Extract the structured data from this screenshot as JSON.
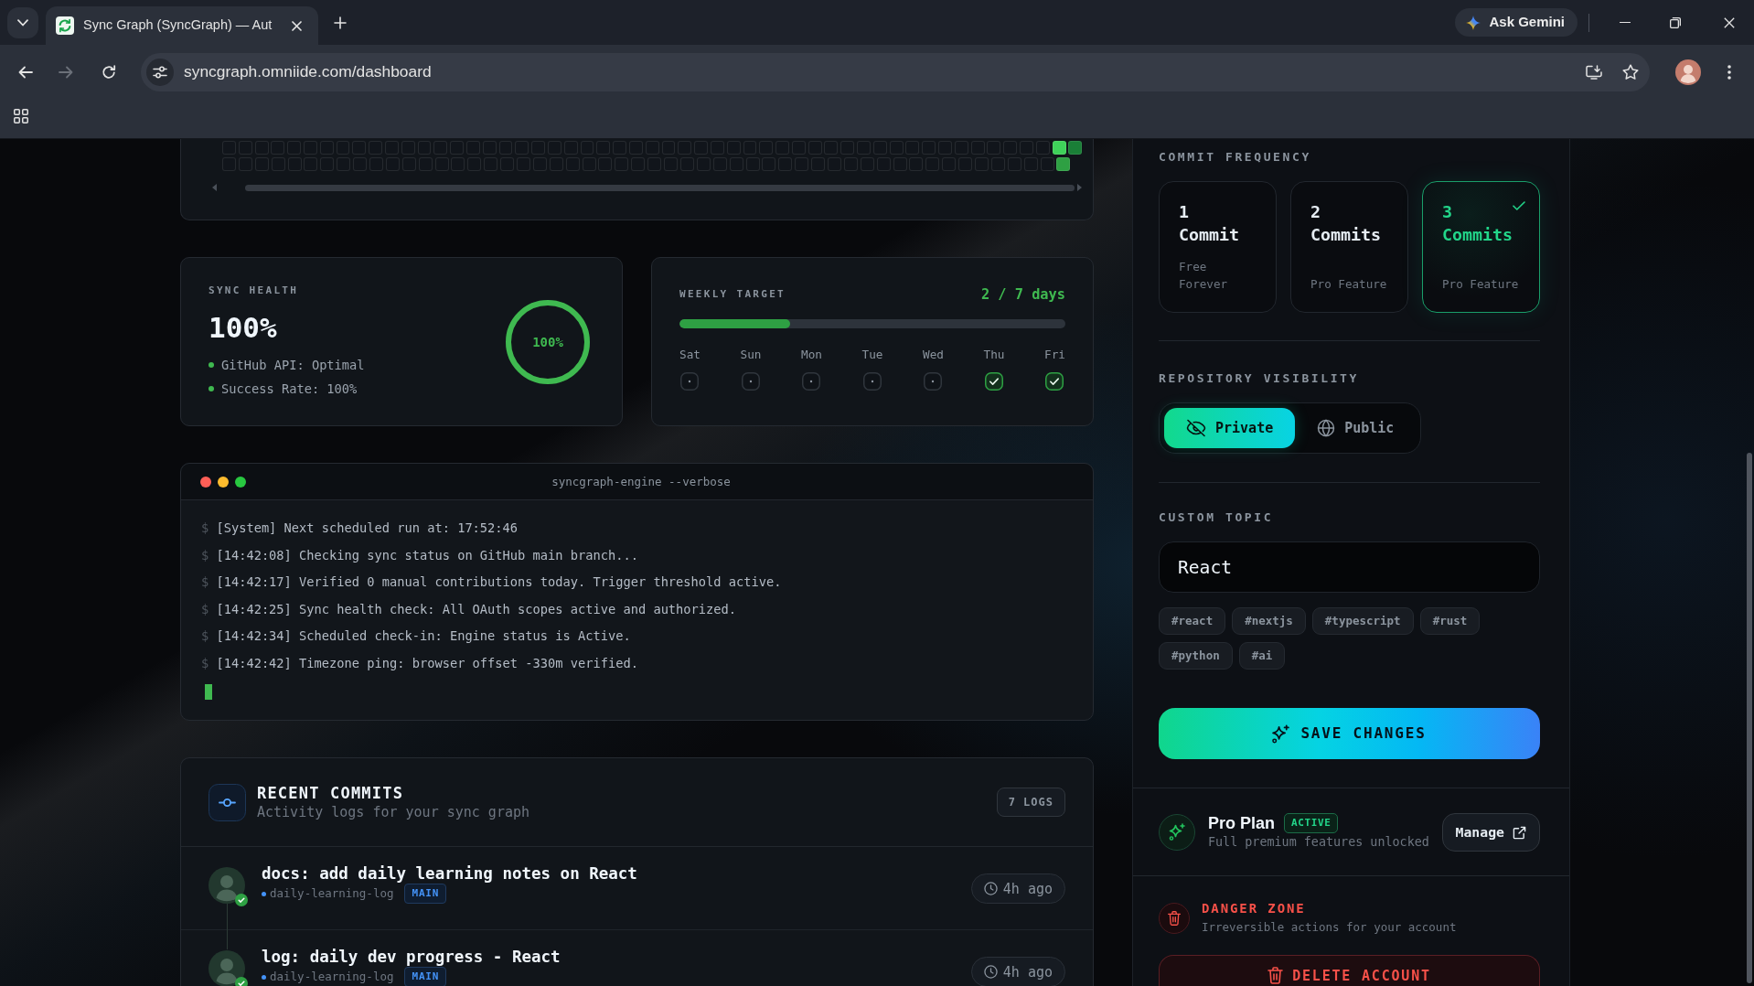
{
  "browser": {
    "tab_title": "Sync Graph (SyncGraph) — Aut",
    "ask_button": "Ask Gemini",
    "nav": [
      {
        "kind": "back",
        "disabled": false
      },
      {
        "kind": "forward",
        "disabled": true
      },
      {
        "kind": "reload",
        "disabled": false
      }
    ],
    "url": "syncgraph.omniide.com/dashboard"
  },
  "contribution_grid": {
    "rows": [
      {
        "cells": [
          {
            "color": "#11151b"
          },
          {
            "color": "#11151b"
          },
          {
            "color": "#11151b"
          },
          {
            "color": "#11151b"
          },
          {
            "color": "#11151b"
          },
          {
            "color": "#11151b"
          },
          {
            "color": "#11151b"
          },
          {
            "color": "#11151b"
          },
          {
            "color": "#11151b"
          },
          {
            "color": "#11151b"
          },
          {
            "color": "#11151b"
          },
          {
            "color": "#11151b"
          },
          {
            "color": "#11151b"
          },
          {
            "color": "#11151b"
          },
          {
            "color": "#11151b"
          },
          {
            "color": "#11151b"
          },
          {
            "color": "#11151b"
          },
          {
            "color": "#11151b"
          },
          {
            "color": "#11151b"
          },
          {
            "color": "#11151b"
          },
          {
            "color": "#11151b"
          },
          {
            "color": "#11151b"
          },
          {
            "color": "#11151b"
          },
          {
            "color": "#11151b"
          },
          {
            "color": "#11151b"
          },
          {
            "color": "#11151b"
          },
          {
            "color": "#11151b"
          },
          {
            "color": "#11151b"
          },
          {
            "color": "#11151b"
          },
          {
            "color": "#11151b"
          },
          {
            "color": "#11151b"
          },
          {
            "color": "#11151b"
          },
          {
            "color": "#11151b"
          },
          {
            "color": "#11151b"
          },
          {
            "color": "#11151b"
          },
          {
            "color": "#11151b"
          },
          {
            "color": "#11151b"
          },
          {
            "color": "#11151b"
          },
          {
            "color": "#11151b"
          },
          {
            "color": "#11151b"
          },
          {
            "color": "#11151b"
          },
          {
            "color": "#11151b"
          },
          {
            "color": "#11151b"
          },
          {
            "color": "#11151b"
          },
          {
            "color": "#11151b"
          },
          {
            "color": "#11151b"
          },
          {
            "color": "#11151b"
          },
          {
            "color": "#11151b"
          },
          {
            "color": "#11151b"
          },
          {
            "color": "#11151b"
          },
          {
            "color": "#11151b"
          },
          {
            "color": "#3fd15a"
          },
          {
            "color": "#1a7f37"
          }
        ]
      },
      {
        "cells": [
          {
            "color": "#11151b"
          },
          {
            "color": "#11151b"
          },
          {
            "color": "#11151b"
          },
          {
            "color": "#11151b"
          },
          {
            "color": "#11151b"
          },
          {
            "color": "#11151b"
          },
          {
            "color": "#11151b"
          },
          {
            "color": "#11151b"
          },
          {
            "color": "#11151b"
          },
          {
            "color": "#11151b"
          },
          {
            "color": "#11151b"
          },
          {
            "color": "#11151b"
          },
          {
            "color": "#11151b"
          },
          {
            "color": "#11151b"
          },
          {
            "color": "#11151b"
          },
          {
            "color": "#11151b"
          },
          {
            "color": "#11151b"
          },
          {
            "color": "#11151b"
          },
          {
            "color": "#11151b"
          },
          {
            "color": "#11151b"
          },
          {
            "color": "#11151b"
          },
          {
            "color": "#11151b"
          },
          {
            "color": "#11151b"
          },
          {
            "color": "#11151b"
          },
          {
            "color": "#11151b"
          },
          {
            "color": "#11151b"
          },
          {
            "color": "#11151b"
          },
          {
            "color": "#11151b"
          },
          {
            "color": "#11151b"
          },
          {
            "color": "#11151b"
          },
          {
            "color": "#11151b"
          },
          {
            "color": "#11151b"
          },
          {
            "color": "#11151b"
          },
          {
            "color": "#11151b"
          },
          {
            "color": "#11151b"
          },
          {
            "color": "#11151b"
          },
          {
            "color": "#11151b"
          },
          {
            "color": "#11151b"
          },
          {
            "color": "#11151b"
          },
          {
            "color": "#11151b"
          },
          {
            "color": "#11151b"
          },
          {
            "color": "#11151b"
          },
          {
            "color": "#11151b"
          },
          {
            "color": "#11151b"
          },
          {
            "color": "#11151b"
          },
          {
            "color": "#11151b"
          },
          {
            "color": "#11151b"
          },
          {
            "color": "#11151b"
          },
          {
            "color": "#11151b"
          },
          {
            "color": "#11151b"
          },
          {
            "color": "#11151b"
          },
          {
            "color": "#2ea043"
          }
        ]
      }
    ]
  },
  "sync_health": {
    "label": "SYNC HEALTH",
    "value": "100%",
    "items": [
      "GitHub API: Optimal",
      "Success Rate: 100%"
    ],
    "ring": {
      "level": 1,
      "reading": "100%"
    }
  },
  "weekly_target": {
    "label": "WEEKLY TARGET",
    "summary": "2 / 7 days",
    "level": 0.2857,
    "days": [
      {
        "label": "Sat",
        "done": false
      },
      {
        "label": "Sun",
        "done": false
      },
      {
        "label": "Mon",
        "done": false
      },
      {
        "label": "Tue",
        "done": false
      },
      {
        "label": "Wed",
        "done": false
      },
      {
        "label": "Thu",
        "done": true
      },
      {
        "label": "Fri",
        "done": true
      }
    ]
  },
  "terminal": {
    "title": "syncgraph-engine --verbose",
    "lines": [
      {
        "prompt": "$",
        "text": "[System] Next scheduled run at: 17:52:46"
      },
      {
        "prompt": "$",
        "text": "[14:42:08] Checking sync status on GitHub main branch..."
      },
      {
        "prompt": "$",
        "text": "[14:42:17] Verified 0 manual contributions today. Trigger threshold active."
      },
      {
        "prompt": "$",
        "text": "[14:42:25] Sync health check: All OAuth scopes active and authorized."
      },
      {
        "prompt": "$",
        "text": "[14:42:34] Scheduled check-in: Engine status is Active."
      },
      {
        "prompt": "$",
        "text": "[14:42:42] Timezone ping: browser offset -330m verified."
      }
    ]
  },
  "recent_commits": {
    "title": "RECENT COMMITS",
    "subtitle": "Activity logs for your sync graph",
    "count": "7 LOGS",
    "commits": [
      {
        "message": "docs: add daily learning notes on React",
        "repo": "daily-learning-log",
        "branch": "MAIN",
        "time": "4h ago",
        "verified": true
      },
      {
        "message": "log: daily dev progress - React",
        "repo": "daily-learning-log",
        "branch": "MAIN",
        "time": "4h ago",
        "verified": true
      }
    ]
  },
  "settings": {
    "commit_frequency": {
      "label": "COMMIT FREQUENCY",
      "options": [
        {
          "title": "1 Commit",
          "note": "Free Forever",
          "selected": false
        },
        {
          "title": "2 Commits",
          "note": "Pro Feature",
          "selected": false
        },
        {
          "title": "3 Commits",
          "note": "Pro Feature",
          "selected": true
        }
      ]
    },
    "visibility": {
      "label": "REPOSITORY VISIBILITY",
      "options": [
        {
          "kind": "private",
          "label": "Private",
          "selected": true
        },
        {
          "kind": "public",
          "label": "Public",
          "selected": false
        }
      ]
    },
    "custom_topic": {
      "label": "CUSTOM TOPIC",
      "value": "React",
      "tags": [
        "#react",
        "#nextjs",
        "#typescript",
        "#rust",
        "#python",
        "#ai"
      ]
    },
    "save_button": "SAVE CHANGES",
    "plan": {
      "name": "Pro Plan",
      "status": "ACTIVE",
      "description": "Full premium features unlocked",
      "button": "Manage"
    },
    "danger_zone": {
      "title": "DANGER ZONE",
      "description": "Irreversible actions for your account",
      "button": "DELETE ACCOUNT"
    }
  }
}
